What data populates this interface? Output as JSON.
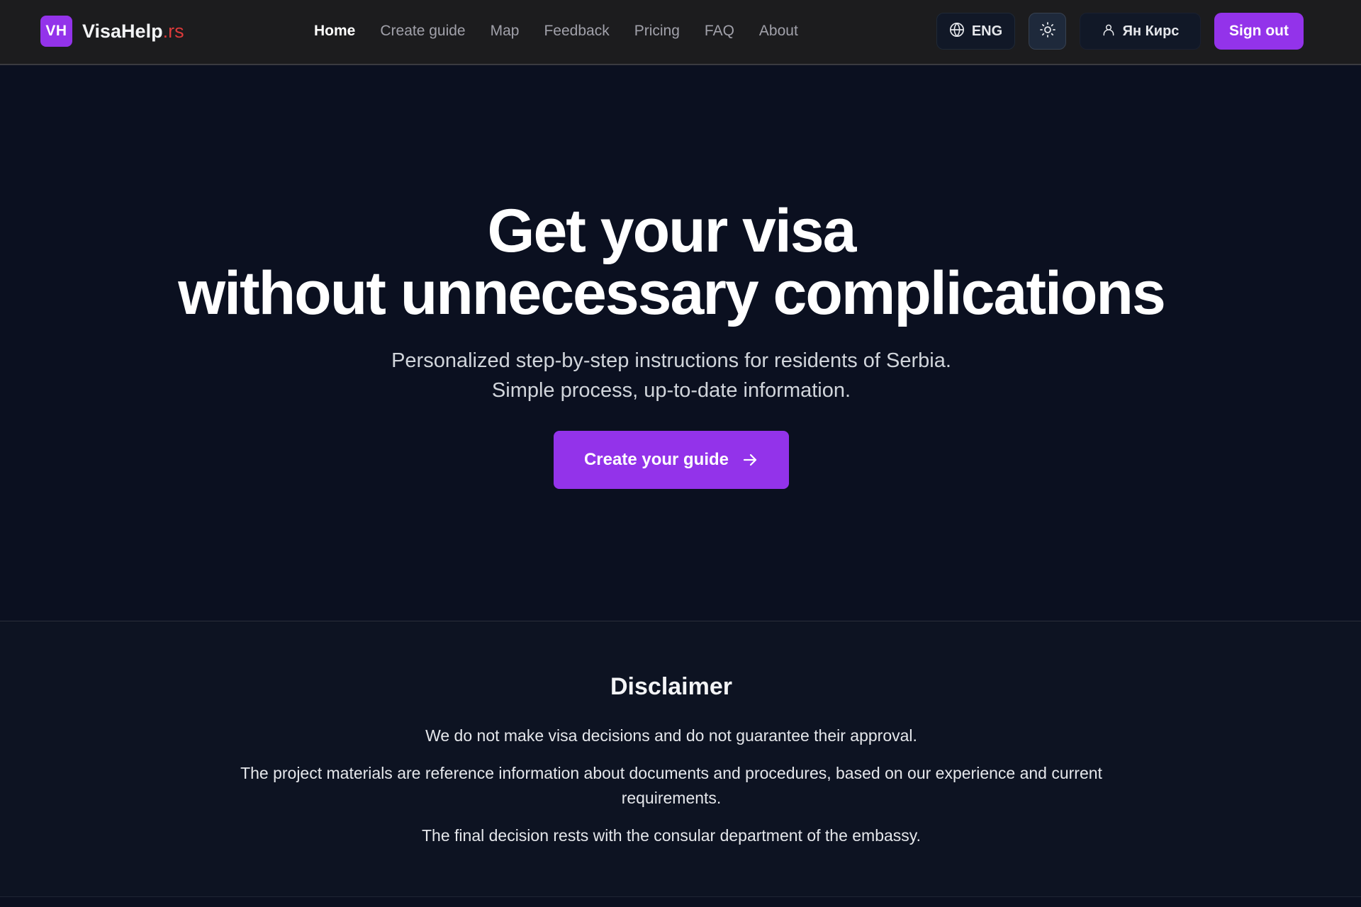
{
  "header": {
    "logo_badge": "VH",
    "logo_name": "VisaHelp",
    "logo_tld": ".rs",
    "nav": [
      {
        "label": "Home",
        "active": true
      },
      {
        "label": "Create guide",
        "active": false
      },
      {
        "label": "Map",
        "active": false
      },
      {
        "label": "Feedback",
        "active": false
      },
      {
        "label": "Pricing",
        "active": false
      },
      {
        "label": "FAQ",
        "active": false
      },
      {
        "label": "About",
        "active": false
      }
    ],
    "language": "ENG",
    "user_name": "Ян Кирс",
    "sign_out_label": "Sign out"
  },
  "hero": {
    "title_line1": "Get your visa",
    "title_line2": "without unnecessary complications",
    "subtitle_line1": "Personalized step-by-step instructions for residents of Serbia.",
    "subtitle_line2": "Simple process, up-to-date information.",
    "cta_label": "Create your guide"
  },
  "disclaimer": {
    "title": "Disclaimer",
    "paragraphs": [
      "We do not make visa decisions and do not guarantee their approval.",
      "The project materials are reference information about documents and procedures, based on our experience and current requirements.",
      "The final decision rests with the consular department of the embassy."
    ]
  },
  "colors": {
    "accent": "#9333ea",
    "tld": "#dc3a3a",
    "background": "#0b1020",
    "header": "#1c1c1e"
  },
  "icons": {
    "language": "globe-icon",
    "theme": "sun-icon",
    "user": "user-icon",
    "cta": "arrow-right-icon"
  }
}
